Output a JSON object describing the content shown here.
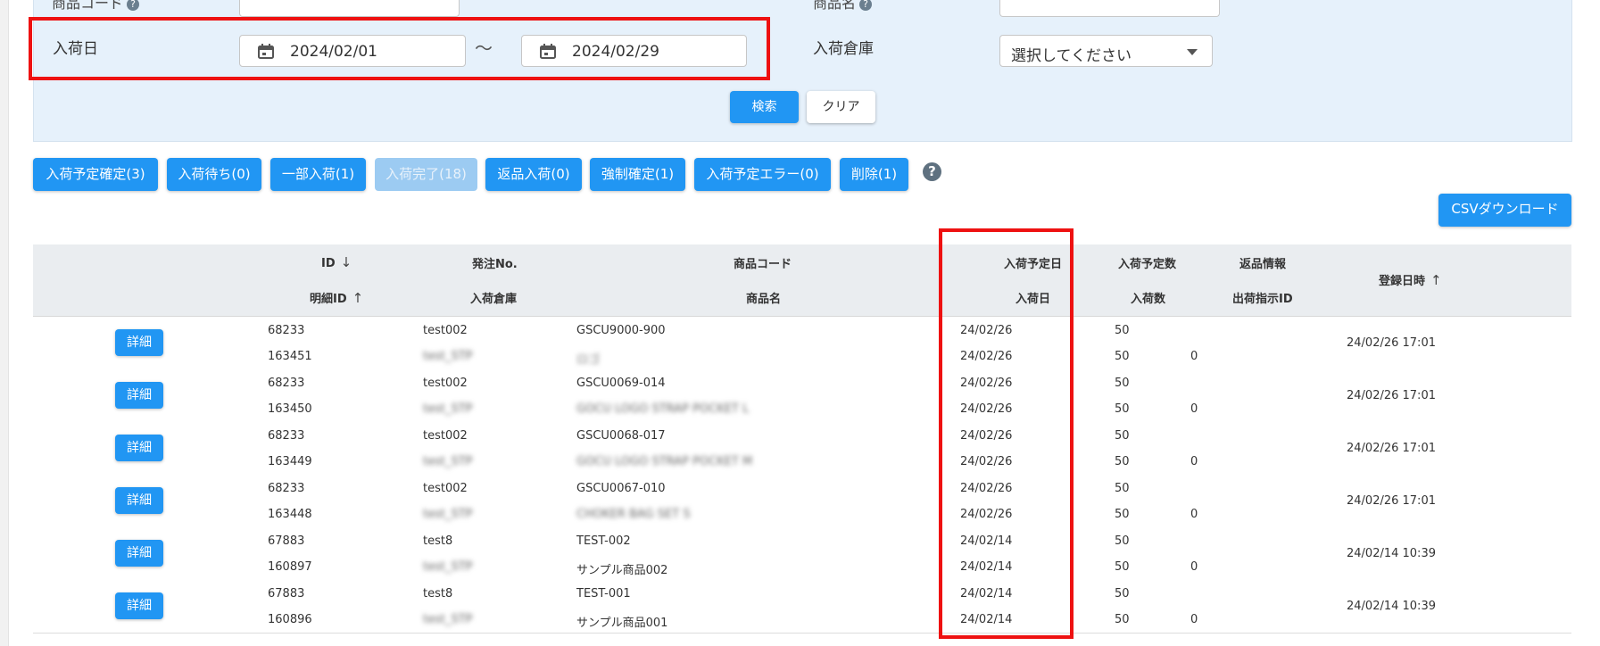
{
  "search": {
    "top_left_label": "商品コード",
    "top_right_label": "商品名",
    "arrival_date_label": "入荷日",
    "date_from": "2024/02/01",
    "tilde": "〜",
    "date_to": "2024/02/29",
    "warehouse_label": "入荷倉庫",
    "warehouse_value": "選択してください",
    "search_button": "検索",
    "clear_button": "クリア"
  },
  "status_buttons": [
    {
      "label": "入荷予定確定(3)",
      "disabled": false
    },
    {
      "label": "入荷待ち(0)",
      "disabled": false
    },
    {
      "label": "一部入荷(1)",
      "disabled": false
    },
    {
      "label": "入荷完了(18)",
      "disabled": true
    },
    {
      "label": "返品入荷(0)",
      "disabled": false
    },
    {
      "label": "強制確定(1)",
      "disabled": false
    },
    {
      "label": "入荷予定エラー(0)",
      "disabled": false
    },
    {
      "label": "削除(1)",
      "disabled": false
    }
  ],
  "help_icon": "?",
  "csv_button": "CSVダウンロード",
  "table": {
    "headers": {
      "id": "ID",
      "order_no": "発注No.",
      "product_code": "商品コード",
      "scheduled_date": "入荷予定日",
      "scheduled_qty": "入荷予定数",
      "return_info": "返品情報",
      "registered_at": "登録日時",
      "detail_id": "明細ID",
      "warehouse": "入荷倉庫",
      "product_name": "商品名",
      "arrival_date": "入荷日",
      "arrival_qty": "入荷数",
      "shipping_id": "出荷指示ID"
    },
    "detail_button": "詳細",
    "rows": [
      {
        "id": "68233",
        "detail_id": "163451",
        "order_no": "test002",
        "warehouse": "test_STP",
        "product_code": "GSCU9000-900",
        "product_name": "ロゴ",
        "scheduled_date": "24/02/26",
        "arrival_date": "24/02/26",
        "scheduled_qty": "50",
        "arrival_qty": "50",
        "return_qty": "0",
        "registered_at": "24/02/26 17:01"
      },
      {
        "id": "68233",
        "detail_id": "163450",
        "order_no": "test002",
        "warehouse": "test_STP",
        "product_code": "GSCU0069-014",
        "product_name": "GOCU LOGO STRAP POCKET L",
        "scheduled_date": "24/02/26",
        "arrival_date": "24/02/26",
        "scheduled_qty": "50",
        "arrival_qty": "50",
        "return_qty": "0",
        "registered_at": "24/02/26 17:01"
      },
      {
        "id": "68233",
        "detail_id": "163449",
        "order_no": "test002",
        "warehouse": "test_STP",
        "product_code": "GSCU0068-017",
        "product_name": "GOCU LOGO STRAP POCKET M",
        "scheduled_date": "24/02/26",
        "arrival_date": "24/02/26",
        "scheduled_qty": "50",
        "arrival_qty": "50",
        "return_qty": "0",
        "registered_at": "24/02/26 17:01"
      },
      {
        "id": "68233",
        "detail_id": "163448",
        "order_no": "test002",
        "warehouse": "test_STP",
        "product_code": "GSCU0067-010",
        "product_name": "CHOKER BAG SET S",
        "scheduled_date": "24/02/26",
        "arrival_date": "24/02/26",
        "scheduled_qty": "50",
        "arrival_qty": "50",
        "return_qty": "0",
        "registered_at": "24/02/26 17:01"
      },
      {
        "id": "67883",
        "detail_id": "160897",
        "order_no": "test8",
        "warehouse": "test_STP",
        "product_code": "TEST-002",
        "product_name": "サンプル商品002",
        "scheduled_date": "24/02/14",
        "arrival_date": "24/02/14",
        "scheduled_qty": "50",
        "arrival_qty": "50",
        "return_qty": "0",
        "registered_at": "24/02/14 10:39"
      },
      {
        "id": "67883",
        "detail_id": "160896",
        "order_no": "test8",
        "warehouse": "test_STP",
        "product_code": "TEST-001",
        "product_name": "サンプル商品001",
        "scheduled_date": "24/02/14",
        "arrival_date": "24/02/14",
        "scheduled_qty": "50",
        "arrival_qty": "50",
        "return_qty": "0",
        "registered_at": "24/02/14 10:39"
      }
    ]
  },
  "colors": {
    "primary": "#2196f3",
    "primary_disabled": "#9ccbf2",
    "panel_bg": "#e6f1fb",
    "highlight": "#ee1111"
  }
}
